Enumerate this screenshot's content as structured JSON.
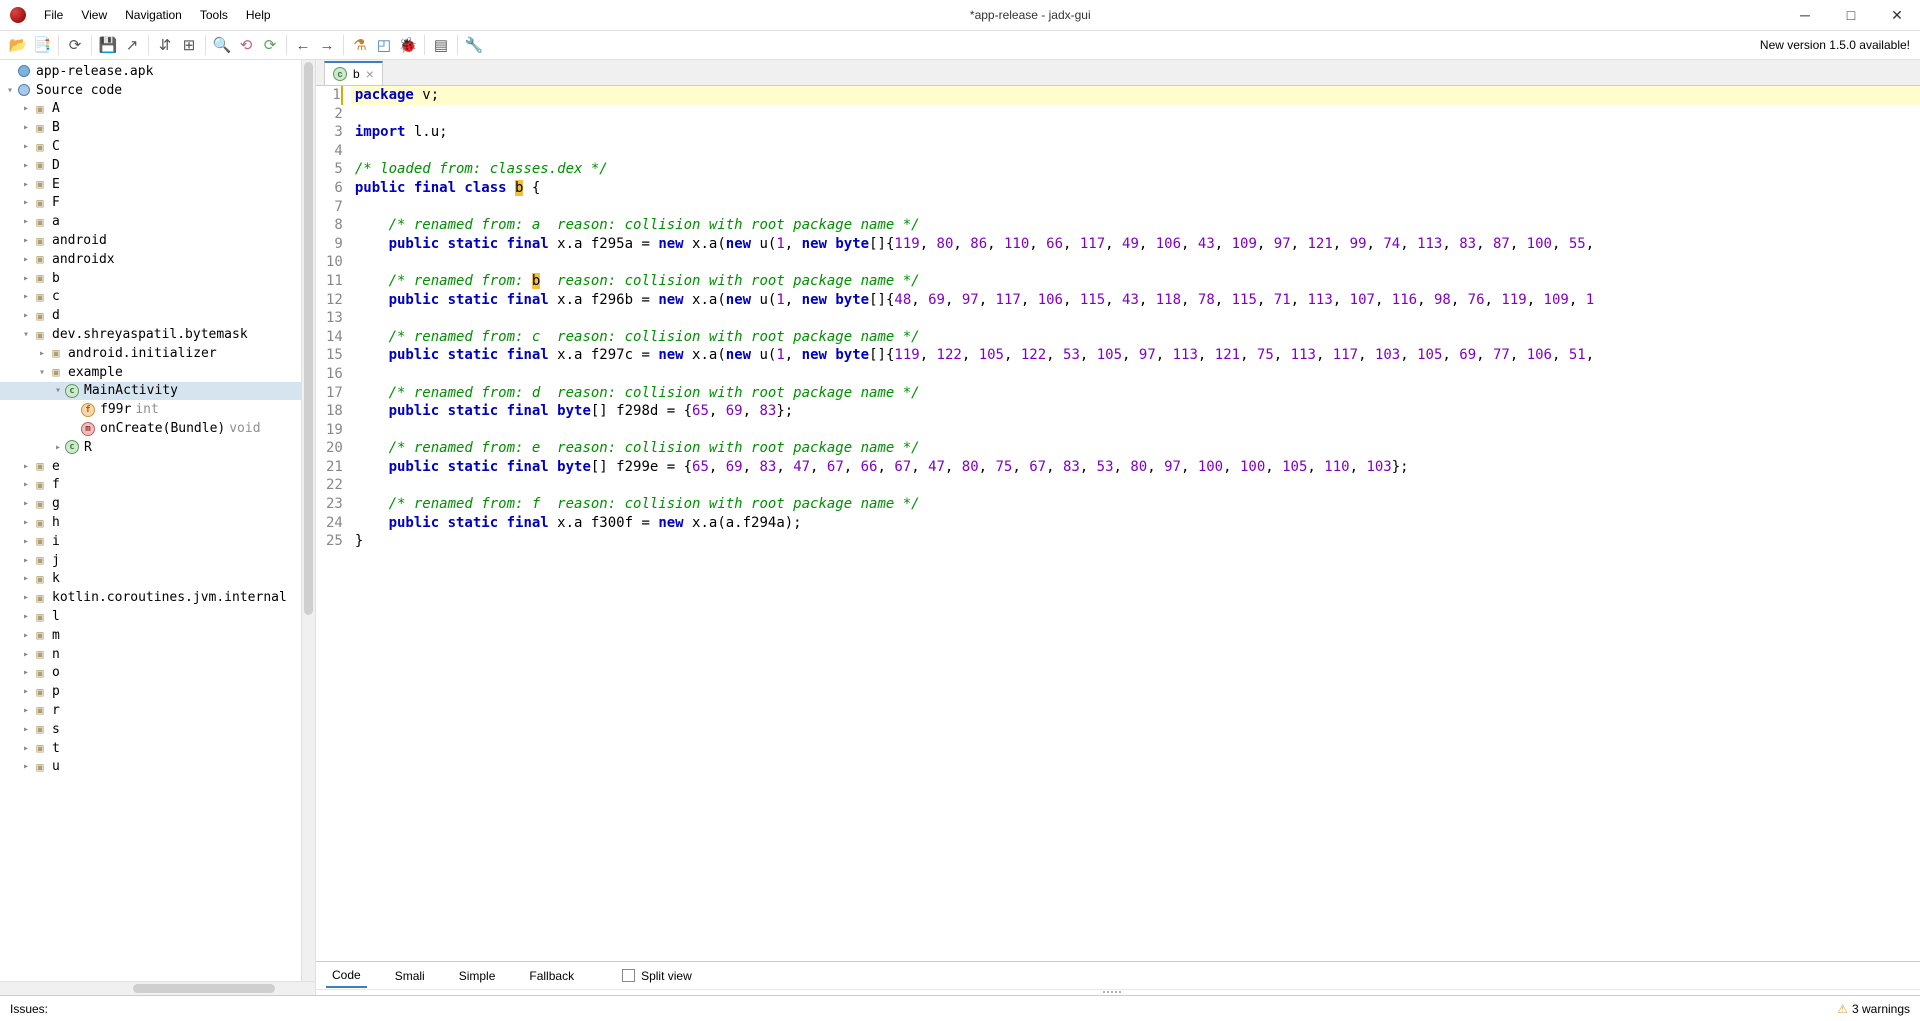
{
  "title": "*app-release - jadx-gui",
  "menu": [
    "File",
    "View",
    "Navigation",
    "Tools",
    "Help"
  ],
  "newVersion": "New version 1.5.0 available!",
  "tree": {
    "root": "app-release.apk",
    "src": "Source code",
    "pkgs_top": [
      "A",
      "B",
      "C",
      "D",
      "E",
      "F",
      "a",
      "android",
      "androidx",
      "b",
      "c",
      "d"
    ],
    "dev": "dev.shreyaspatil.bytemask",
    "dev_child1": "android.initializer",
    "dev_child2": "example",
    "main": "MainActivity",
    "f99r": "f99r",
    "f99r_t": "int",
    "onCreate": "onCreate(Bundle)",
    "onCreate_t": "void",
    "R": "R",
    "pkgs_bottom": [
      "e",
      "f",
      "g",
      "h",
      "i",
      "j",
      "k",
      "kotlin.coroutines.jvm.internal",
      "l",
      "m",
      "n",
      "o",
      "p",
      "r",
      "s",
      "t",
      "u"
    ]
  },
  "tab": {
    "name": "b"
  },
  "code": {
    "lines": [
      {
        "n": 1,
        "hl": true,
        "tokens": [
          {
            "t": "package",
            "c": "kw"
          },
          {
            "t": " v;"
          }
        ]
      },
      {
        "n": 2,
        "tokens": []
      },
      {
        "n": 3,
        "tokens": [
          {
            "t": "import",
            "c": "kw"
          },
          {
            "t": " l.u;"
          }
        ]
      },
      {
        "n": 4,
        "tokens": []
      },
      {
        "n": 5,
        "tokens": [
          {
            "t": "/* loaded from: classes.dex */",
            "c": "cm"
          }
        ]
      },
      {
        "n": 6,
        "tokens": [
          {
            "t": "public final class",
            "c": "kw"
          },
          {
            "t": " "
          },
          {
            "t": "b",
            "c": "mark"
          },
          {
            "t": " {"
          }
        ]
      },
      {
        "n": 7,
        "tokens": []
      },
      {
        "n": 8,
        "tokens": [
          {
            "t": "    "
          },
          {
            "t": "/* renamed from: a  reason: collision with root package name */",
            "c": "cm"
          }
        ]
      },
      {
        "n": 9,
        "tokens": [
          {
            "t": "    "
          },
          {
            "t": "public static final",
            "c": "kw"
          },
          {
            "t": " x.a f295a = "
          },
          {
            "t": "new",
            "c": "kw"
          },
          {
            "t": " x.a("
          },
          {
            "t": "new",
            "c": "kw"
          },
          {
            "t": " u("
          },
          {
            "t": "1",
            "c": "nm"
          },
          {
            "t": ", "
          },
          {
            "t": "new byte",
            "c": "kw"
          },
          {
            "t": "[]{"
          },
          {
            "t": "119",
            "c": "nm"
          },
          {
            "t": ", "
          },
          {
            "t": "80",
            "c": "nm"
          },
          {
            "t": ", "
          },
          {
            "t": "86",
            "c": "nm"
          },
          {
            "t": ", "
          },
          {
            "t": "110",
            "c": "nm"
          },
          {
            "t": ", "
          },
          {
            "t": "66",
            "c": "nm"
          },
          {
            "t": ", "
          },
          {
            "t": "117",
            "c": "nm"
          },
          {
            "t": ", "
          },
          {
            "t": "49",
            "c": "nm"
          },
          {
            "t": ", "
          },
          {
            "t": "106",
            "c": "nm"
          },
          {
            "t": ", "
          },
          {
            "t": "43",
            "c": "nm"
          },
          {
            "t": ", "
          },
          {
            "t": "109",
            "c": "nm"
          },
          {
            "t": ", "
          },
          {
            "t": "97",
            "c": "nm"
          },
          {
            "t": ", "
          },
          {
            "t": "121",
            "c": "nm"
          },
          {
            "t": ", "
          },
          {
            "t": "99",
            "c": "nm"
          },
          {
            "t": ", "
          },
          {
            "t": "74",
            "c": "nm"
          },
          {
            "t": ", "
          },
          {
            "t": "113",
            "c": "nm"
          },
          {
            "t": ", "
          },
          {
            "t": "83",
            "c": "nm"
          },
          {
            "t": ", "
          },
          {
            "t": "87",
            "c": "nm"
          },
          {
            "t": ", "
          },
          {
            "t": "100",
            "c": "nm"
          },
          {
            "t": ", "
          },
          {
            "t": "55",
            "c": "nm"
          },
          {
            "t": ", "
          }
        ]
      },
      {
        "n": 10,
        "tokens": []
      },
      {
        "n": 11,
        "tokens": [
          {
            "t": "    "
          },
          {
            "t": "/* renamed from: ",
            "c": "cm"
          },
          {
            "t": "b",
            "c": "mark"
          },
          {
            "t": "  reason: collision with root package name */",
            "c": "cm"
          }
        ]
      },
      {
        "n": 12,
        "tokens": [
          {
            "t": "    "
          },
          {
            "t": "public static final",
            "c": "kw"
          },
          {
            "t": " x.a f296b = "
          },
          {
            "t": "new",
            "c": "kw"
          },
          {
            "t": " x.a("
          },
          {
            "t": "new",
            "c": "kw"
          },
          {
            "t": " u("
          },
          {
            "t": "1",
            "c": "nm"
          },
          {
            "t": ", "
          },
          {
            "t": "new byte",
            "c": "kw"
          },
          {
            "t": "[]{"
          },
          {
            "t": "48",
            "c": "nm"
          },
          {
            "t": ", "
          },
          {
            "t": "69",
            "c": "nm"
          },
          {
            "t": ", "
          },
          {
            "t": "97",
            "c": "nm"
          },
          {
            "t": ", "
          },
          {
            "t": "117",
            "c": "nm"
          },
          {
            "t": ", "
          },
          {
            "t": "106",
            "c": "nm"
          },
          {
            "t": ", "
          },
          {
            "t": "115",
            "c": "nm"
          },
          {
            "t": ", "
          },
          {
            "t": "43",
            "c": "nm"
          },
          {
            "t": ", "
          },
          {
            "t": "118",
            "c": "nm"
          },
          {
            "t": ", "
          },
          {
            "t": "78",
            "c": "nm"
          },
          {
            "t": ", "
          },
          {
            "t": "115",
            "c": "nm"
          },
          {
            "t": ", "
          },
          {
            "t": "71",
            "c": "nm"
          },
          {
            "t": ", "
          },
          {
            "t": "113",
            "c": "nm"
          },
          {
            "t": ", "
          },
          {
            "t": "107",
            "c": "nm"
          },
          {
            "t": ", "
          },
          {
            "t": "116",
            "c": "nm"
          },
          {
            "t": ", "
          },
          {
            "t": "98",
            "c": "nm"
          },
          {
            "t": ", "
          },
          {
            "t": "76",
            "c": "nm"
          },
          {
            "t": ", "
          },
          {
            "t": "119",
            "c": "nm"
          },
          {
            "t": ", "
          },
          {
            "t": "109",
            "c": "nm"
          },
          {
            "t": ", "
          },
          {
            "t": "1",
            "c": "nm"
          }
        ]
      },
      {
        "n": 13,
        "tokens": []
      },
      {
        "n": 14,
        "tokens": [
          {
            "t": "    "
          },
          {
            "t": "/* renamed from: c  reason: collision with root package name */",
            "c": "cm"
          }
        ]
      },
      {
        "n": 15,
        "tokens": [
          {
            "t": "    "
          },
          {
            "t": "public static final",
            "c": "kw"
          },
          {
            "t": " x.a f297c = "
          },
          {
            "t": "new",
            "c": "kw"
          },
          {
            "t": " x.a("
          },
          {
            "t": "new",
            "c": "kw"
          },
          {
            "t": " u("
          },
          {
            "t": "1",
            "c": "nm"
          },
          {
            "t": ", "
          },
          {
            "t": "new byte",
            "c": "kw"
          },
          {
            "t": "[]{"
          },
          {
            "t": "119",
            "c": "nm"
          },
          {
            "t": ", "
          },
          {
            "t": "122",
            "c": "nm"
          },
          {
            "t": ", "
          },
          {
            "t": "105",
            "c": "nm"
          },
          {
            "t": ", "
          },
          {
            "t": "122",
            "c": "nm"
          },
          {
            "t": ", "
          },
          {
            "t": "53",
            "c": "nm"
          },
          {
            "t": ", "
          },
          {
            "t": "105",
            "c": "nm"
          },
          {
            "t": ", "
          },
          {
            "t": "97",
            "c": "nm"
          },
          {
            "t": ", "
          },
          {
            "t": "113",
            "c": "nm"
          },
          {
            "t": ", "
          },
          {
            "t": "121",
            "c": "nm"
          },
          {
            "t": ", "
          },
          {
            "t": "75",
            "c": "nm"
          },
          {
            "t": ", "
          },
          {
            "t": "113",
            "c": "nm"
          },
          {
            "t": ", "
          },
          {
            "t": "117",
            "c": "nm"
          },
          {
            "t": ", "
          },
          {
            "t": "103",
            "c": "nm"
          },
          {
            "t": ", "
          },
          {
            "t": "105",
            "c": "nm"
          },
          {
            "t": ", "
          },
          {
            "t": "69",
            "c": "nm"
          },
          {
            "t": ", "
          },
          {
            "t": "77",
            "c": "nm"
          },
          {
            "t": ", "
          },
          {
            "t": "106",
            "c": "nm"
          },
          {
            "t": ", "
          },
          {
            "t": "51",
            "c": "nm"
          },
          {
            "t": ", "
          }
        ]
      },
      {
        "n": 16,
        "tokens": []
      },
      {
        "n": 17,
        "tokens": [
          {
            "t": "    "
          },
          {
            "t": "/* renamed from: d  reason: collision with root package name */",
            "c": "cm"
          }
        ]
      },
      {
        "n": 18,
        "tokens": [
          {
            "t": "    "
          },
          {
            "t": "public static final byte",
            "c": "kw"
          },
          {
            "t": "[] f298d = {"
          },
          {
            "t": "65",
            "c": "nm"
          },
          {
            "t": ", "
          },
          {
            "t": "69",
            "c": "nm"
          },
          {
            "t": ", "
          },
          {
            "t": "83",
            "c": "nm"
          },
          {
            "t": "};"
          }
        ]
      },
      {
        "n": 19,
        "tokens": []
      },
      {
        "n": 20,
        "tokens": [
          {
            "t": "    "
          },
          {
            "t": "/* renamed from: e  reason: collision with root package name */",
            "c": "cm"
          }
        ]
      },
      {
        "n": 21,
        "tokens": [
          {
            "t": "    "
          },
          {
            "t": "public static final byte",
            "c": "kw"
          },
          {
            "t": "[] f299e = {"
          },
          {
            "t": "65",
            "c": "nm"
          },
          {
            "t": ", "
          },
          {
            "t": "69",
            "c": "nm"
          },
          {
            "t": ", "
          },
          {
            "t": "83",
            "c": "nm"
          },
          {
            "t": ", "
          },
          {
            "t": "47",
            "c": "nm"
          },
          {
            "t": ", "
          },
          {
            "t": "67",
            "c": "nm"
          },
          {
            "t": ", "
          },
          {
            "t": "66",
            "c": "nm"
          },
          {
            "t": ", "
          },
          {
            "t": "67",
            "c": "nm"
          },
          {
            "t": ", "
          },
          {
            "t": "47",
            "c": "nm"
          },
          {
            "t": ", "
          },
          {
            "t": "80",
            "c": "nm"
          },
          {
            "t": ", "
          },
          {
            "t": "75",
            "c": "nm"
          },
          {
            "t": ", "
          },
          {
            "t": "67",
            "c": "nm"
          },
          {
            "t": ", "
          },
          {
            "t": "83",
            "c": "nm"
          },
          {
            "t": ", "
          },
          {
            "t": "53",
            "c": "nm"
          },
          {
            "t": ", "
          },
          {
            "t": "80",
            "c": "nm"
          },
          {
            "t": ", "
          },
          {
            "t": "97",
            "c": "nm"
          },
          {
            "t": ", "
          },
          {
            "t": "100",
            "c": "nm"
          },
          {
            "t": ", "
          },
          {
            "t": "100",
            "c": "nm"
          },
          {
            "t": ", "
          },
          {
            "t": "105",
            "c": "nm"
          },
          {
            "t": ", "
          },
          {
            "t": "110",
            "c": "nm"
          },
          {
            "t": ", "
          },
          {
            "t": "103",
            "c": "nm"
          },
          {
            "t": "};"
          }
        ]
      },
      {
        "n": 22,
        "tokens": []
      },
      {
        "n": 23,
        "tokens": [
          {
            "t": "    "
          },
          {
            "t": "/* renamed from: f  reason: collision with root package name */",
            "c": "cm"
          }
        ]
      },
      {
        "n": 24,
        "tokens": [
          {
            "t": "    "
          },
          {
            "t": "public static final",
            "c": "kw"
          },
          {
            "t": " x.a f300f = "
          },
          {
            "t": "new",
            "c": "kw"
          },
          {
            "t": " x.a(a.f294a);"
          }
        ]
      },
      {
        "n": 25,
        "tokens": [
          {
            "t": "}"
          }
        ]
      }
    ]
  },
  "bottomTabs": [
    "Code",
    "Smali",
    "Simple",
    "Fallback"
  ],
  "splitView": "Split view",
  "status": {
    "issues": "Issues:",
    "warnings": "3 warnings"
  }
}
